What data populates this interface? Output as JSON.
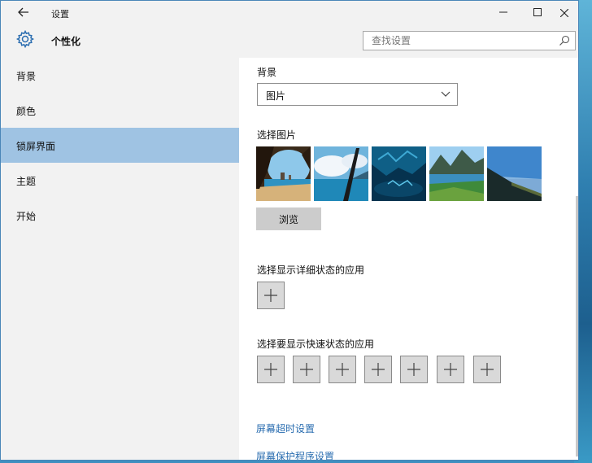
{
  "window": {
    "title": "设置",
    "back_icon": "back-arrow-icon",
    "minimize_icon": "minimize-icon",
    "maximize_icon": "maximize-icon",
    "close_icon": "close-icon"
  },
  "header": {
    "page_title": "个性化",
    "icon": "gear-icon",
    "search_placeholder": "查找设置"
  },
  "sidebar": {
    "items": [
      {
        "label": "背景",
        "active": false
      },
      {
        "label": "颜色",
        "active": false
      },
      {
        "label": "锁屏界面",
        "active": true
      },
      {
        "label": "主题",
        "active": false
      },
      {
        "label": "开始",
        "active": false
      }
    ]
  },
  "content": {
    "background_label": "背景",
    "background_value": "图片",
    "choose_picture_label": "选择图片",
    "browse_label": "浏览",
    "detailed_status_label": "选择显示详细状态的应用",
    "quick_status_label": "选择要显示快速状态的应用",
    "quick_status_slots": 7,
    "links": [
      "屏幕超时设置",
      "屏幕保护程序设置"
    ]
  },
  "colors": {
    "accent": "#2a6db0",
    "sidebar_active": "#9fc3e3",
    "window_bg": "#f2f2f2"
  }
}
